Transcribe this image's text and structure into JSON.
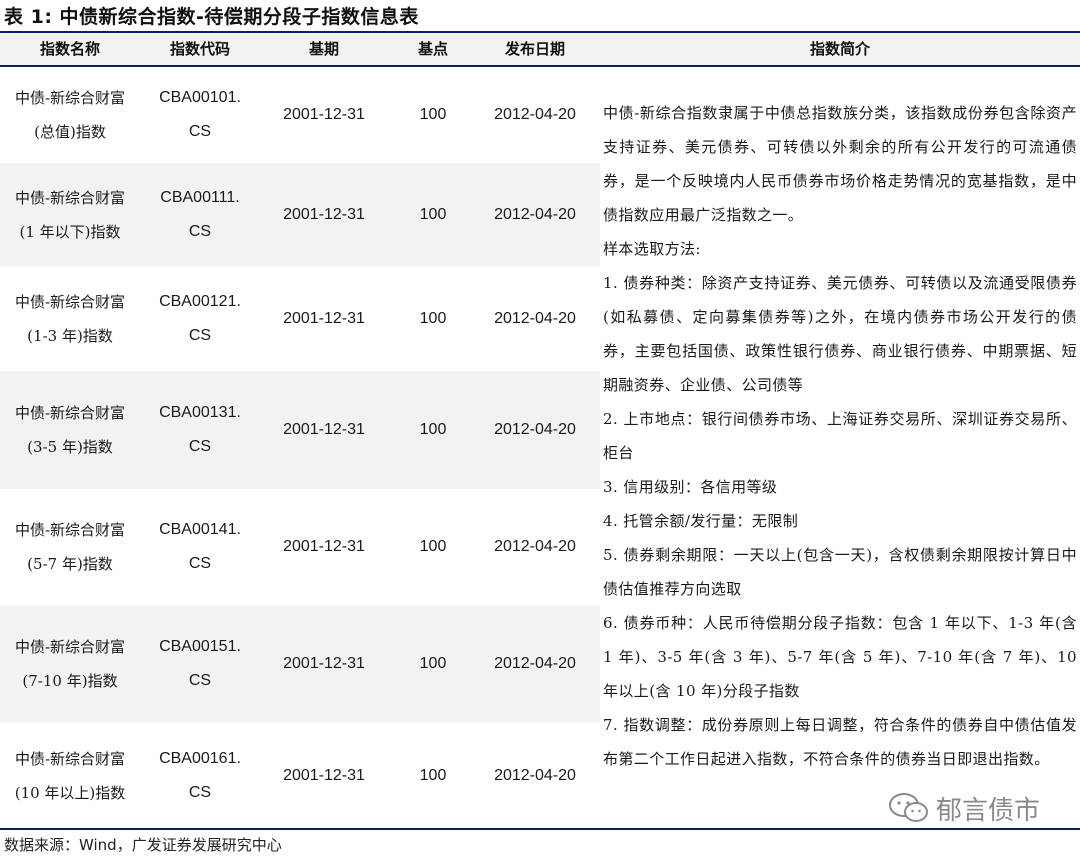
{
  "title": "表 1:  中债新综合指数-待偿期分段子指数信息表",
  "columns": [
    "指数名称",
    "指数代码",
    "基期",
    "基点",
    "发布日期",
    "指数简介"
  ],
  "rows": [
    {
      "name_line1": "中债-新综合财富",
      "name_line2": "(总值)指数",
      "code_line1": "CBA00101.",
      "code_line2": "CS",
      "base": "2001-12-31",
      "point": "100",
      "date": "2012-04-20"
    },
    {
      "name_line1": "中债-新综合财富",
      "name_line2": "(1 年以下)指数",
      "code_line1": "CBA00111.",
      "code_line2": "CS",
      "base": "2001-12-31",
      "point": "100",
      "date": "2012-04-20"
    },
    {
      "name_line1": "中债-新综合财富",
      "name_line2": "(1-3 年)指数",
      "code_line1": "CBA00121.",
      "code_line2": "CS",
      "base": "2001-12-31",
      "point": "100",
      "date": "2012-04-20"
    },
    {
      "name_line1": "中债-新综合财富",
      "name_line2": "(3-5 年)指数",
      "code_line1": "CBA00131.",
      "code_line2": "CS",
      "base": "2001-12-31",
      "point": "100",
      "date": "2012-04-20"
    },
    {
      "name_line1": "中债-新综合财富",
      "name_line2": "(5-7 年)指数",
      "code_line1": "CBA00141.",
      "code_line2": "CS",
      "base": "2001-12-31",
      "point": "100",
      "date": "2012-04-20"
    },
    {
      "name_line1": "中债-新综合财富",
      "name_line2": "(7-10 年)指数",
      "code_line1": "CBA00151.",
      "code_line2": "CS",
      "base": "2001-12-31",
      "point": "100",
      "date": "2012-04-20"
    },
    {
      "name_line1": "中债-新综合财富",
      "name_line2": "(10 年以上)指数",
      "code_line1": "CBA00161.",
      "code_line2": "CS",
      "base": "2001-12-31",
      "point": "100",
      "date": "2012-04-20"
    }
  ],
  "description": [
    "中债-新综合指数隶属于中债总指数族分类，该指数成份券包含除资产支持证券、美元债券、可转债以外剩余的所有公开发行的可流通债券，是一个反映境内人民币债券市场价格走势情况的宽基指数，是中债指数应用最广泛指数之一。",
    "样本选取方法:",
    "1. 债券种类：除资产支持证券、美元债券、可转债以及流通受限债券(如私募债、定向募集债券等)之外，在境内债券市场公开发行的债券，主要包括国债、政策性银行债券、商业银行债券、中期票据、短期融资券、企业债、公司债等",
    "2. 上市地点：银行间债券市场、上海证券交易所、深圳证券交易所、柜台",
    "3. 信用级别：各信用等级",
    "4. 托管余额/发行量：无限制",
    "5. 债券剩余期限：一天以上(包含一天)，含权债剩余期限按计算日中债估值推荐方向选取",
    "6. 债券币种：人民币待偿期分段子指数：包含 1 年以下、1-3 年(含 1 年)、3-5 年(含 3 年)、5-7 年(含 5 年)、7-10 年(含 7 年)、10 年以上(含 10 年)分段子指数",
    "7. 指数调整：成份券原则上每日调整，符合条件的债券自中债估值发布第二个工作日起进入指数，不符合条件的债券当日即退出指数。"
  ],
  "source": "数据来源：Wind，广发证券发展研究中心",
  "watermark": "郁言债市",
  "colors": {
    "rule": "#0b1f6b",
    "header_bg": "#f2f2f2",
    "row_shade": "#f2f2f2",
    "watermark": "#8a8a8a"
  }
}
